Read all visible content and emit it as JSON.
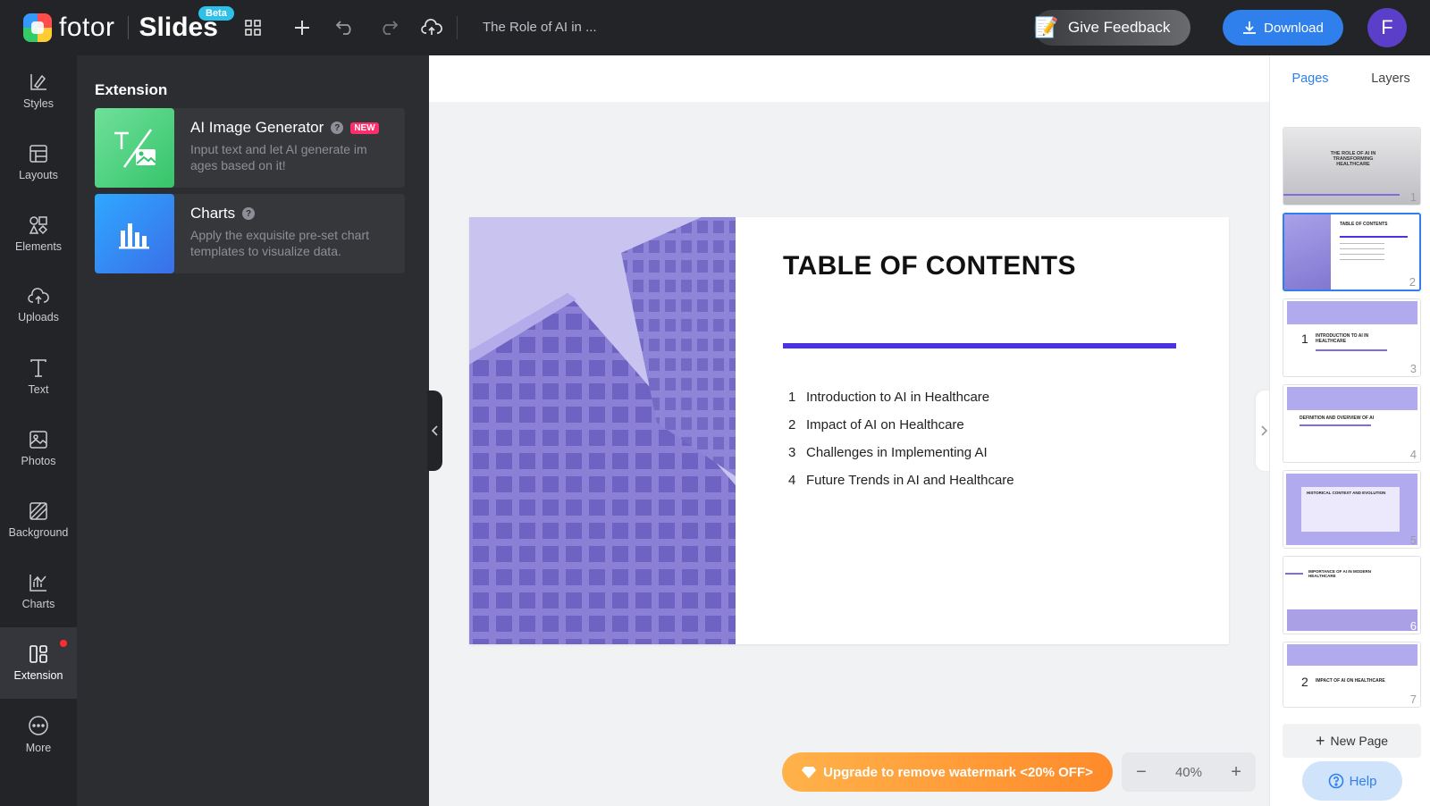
{
  "app": {
    "brand": "fotor",
    "product": "Slides",
    "beta_label": "Beta",
    "doc_title": "The Role of AI in ...",
    "feedback_label": "Give Feedback",
    "download_label": "Download",
    "avatar_initial": "F"
  },
  "rail": {
    "items": [
      {
        "label": "Styles",
        "icon": "styles-icon"
      },
      {
        "label": "Layouts",
        "icon": "layouts-icon"
      },
      {
        "label": "Elements",
        "icon": "elements-icon"
      },
      {
        "label": "Uploads",
        "icon": "upload-icon"
      },
      {
        "label": "Text",
        "icon": "text-icon"
      },
      {
        "label": "Photos",
        "icon": "photos-icon"
      },
      {
        "label": "Background",
        "icon": "background-icon"
      },
      {
        "label": "Charts",
        "icon": "charts-icon"
      },
      {
        "label": "Extension",
        "icon": "extension-icon"
      },
      {
        "label": "More",
        "icon": "more-icon"
      }
    ],
    "active": "Extension"
  },
  "panel": {
    "title": "Extension",
    "cards": [
      {
        "name": "AI Image Generator",
        "badge": "NEW",
        "desc": "Input text and let AI generate im ages based on it!"
      },
      {
        "name": "Charts",
        "desc": "Apply the exquisite pre-set chart templates to visualize data."
      }
    ]
  },
  "slide": {
    "title": "TABLE OF CONTENTS",
    "items": [
      {
        "num": "1",
        "text": "Introduction to AI in Healthcare"
      },
      {
        "num": "2",
        "text": "Impact of AI on Healthcare"
      },
      {
        "num": "3",
        "text": "Challenges in Implementing AI"
      },
      {
        "num": "4",
        "text": "Future Trends in AI and Healthcare"
      }
    ],
    "accent": "#4a34e0"
  },
  "footer": {
    "upgrade_label": "Upgrade to remove watermark <20% OFF>",
    "zoom": "40%"
  },
  "pages_panel": {
    "tabs": [
      "Pages",
      "Layers"
    ],
    "active_tab": "Pages",
    "thumbs": [
      {
        "num": "1",
        "label": "THE ROLE OF AI IN TRANSFORMING HEALTHCARE"
      },
      {
        "num": "2",
        "label": "TABLE OF CONTENTS"
      },
      {
        "num": "3",
        "label": "INTRODUCTION TO AI IN HEALTHCARE"
      },
      {
        "num": "4",
        "label": "DEFINITION AND OVERVIEW OF AI"
      },
      {
        "num": "5",
        "label": "HISTORICAL CONTEXT AND EVOLUTION"
      },
      {
        "num": "6",
        "label": "IMPORTANCE OF AI IN MODERN HEALTHCARE"
      },
      {
        "num": "7",
        "label": "IMPACT OF AI ON HEALTHCARE"
      }
    ],
    "active_thumb": "2",
    "new_page_label": "New Page",
    "help_label": "Help"
  }
}
